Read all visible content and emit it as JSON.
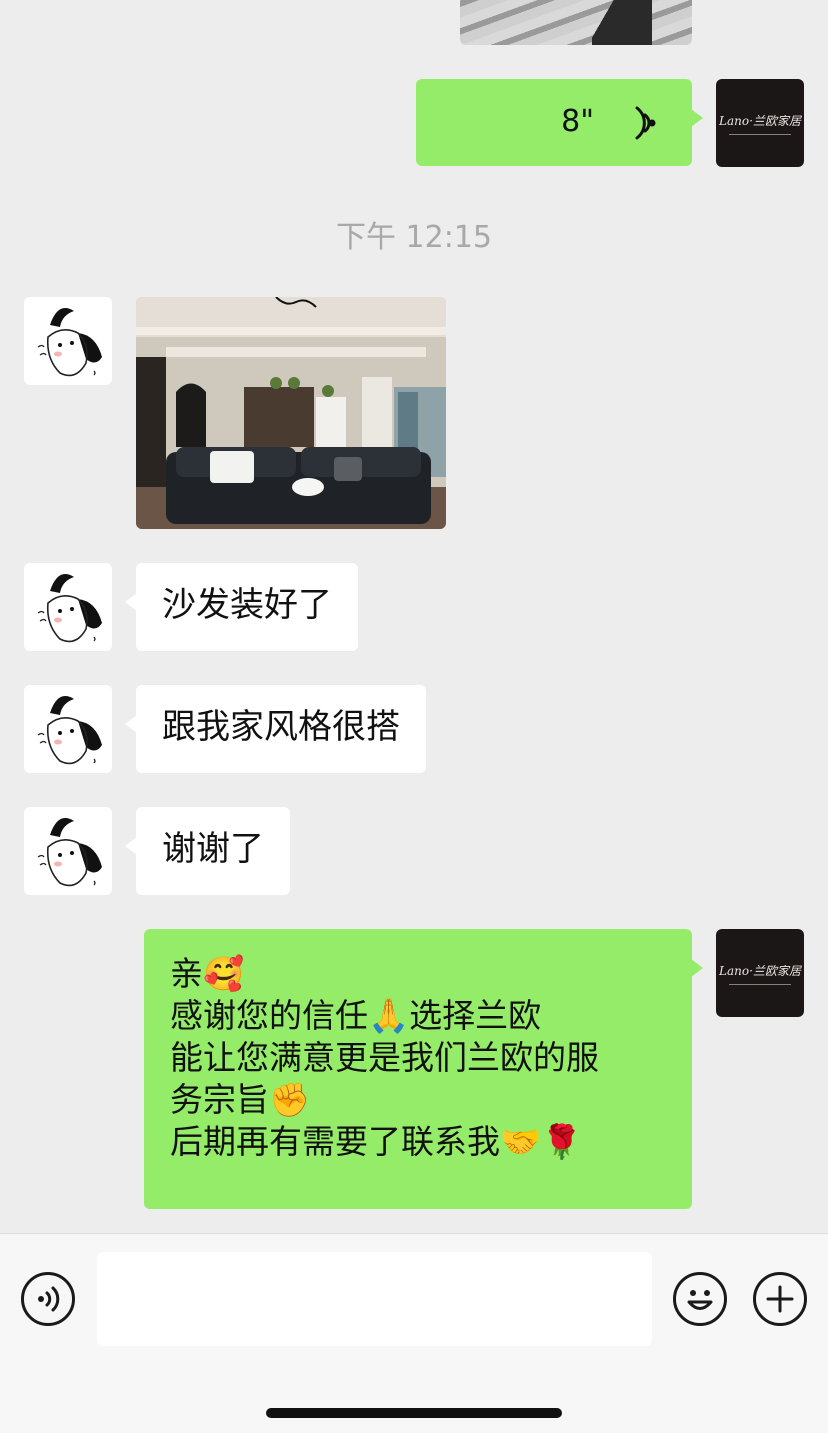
{
  "colors": {
    "background": "#ededed",
    "sent_bubble": "#95ec69",
    "received_bubble": "#ffffff",
    "timestamp": "#a8a8a8"
  },
  "brand_avatar": {
    "logo_text": "Lano·兰欧家居"
  },
  "messages": {
    "voice": {
      "duration": "8\"",
      "icon": "voice-wave-icon"
    },
    "timestamp": "下午 12:15",
    "photo": {
      "icon": "sofa-living-room-photo"
    },
    "text1": "沙发装好了",
    "text2": "跟我家风格很搭",
    "text3": "谢谢了",
    "reply_lines": [
      "亲🥰",
      "感谢您的信任🙏选择兰欧",
      "能让您满意更是我们兰欧的服",
      "务宗旨✊",
      "后期再有需要了联系我🤝🌹"
    ]
  },
  "input_bar": {
    "voice_button_icon": "voice-mode-icon",
    "emoji_button_icon": "emoji-icon",
    "plus_button_icon": "plus-icon",
    "text": ""
  }
}
